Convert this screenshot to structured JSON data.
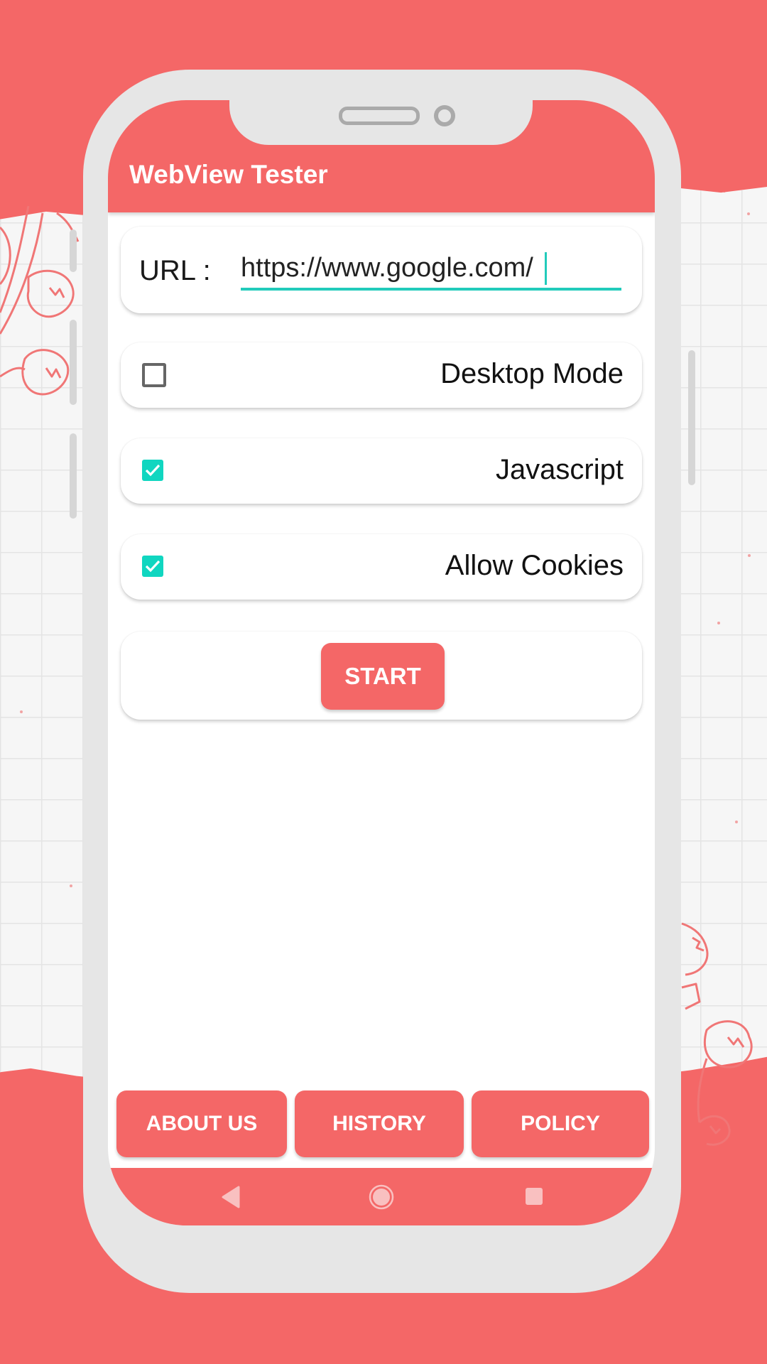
{
  "app": {
    "title": "WebView Tester"
  },
  "url_field": {
    "label": "URL :",
    "value": "https://www.google.com/",
    "focused": true
  },
  "options": [
    {
      "label": "Desktop Mode",
      "checked": false
    },
    {
      "label": "Javascript",
      "checked": true
    },
    {
      "label": "Allow Cookies",
      "checked": true
    }
  ],
  "start_button": {
    "label": "START"
  },
  "bottom_buttons": [
    {
      "label": "ABOUT US"
    },
    {
      "label": "HISTORY"
    },
    {
      "label": "POLICY"
    }
  ],
  "nav_bar": {
    "icons": [
      "back-icon",
      "home-icon",
      "recents-icon"
    ]
  },
  "colors": {
    "primary": "#f46767",
    "accent": "#10d6c0",
    "frame": "#e6e6e6",
    "text": "#111111"
  }
}
